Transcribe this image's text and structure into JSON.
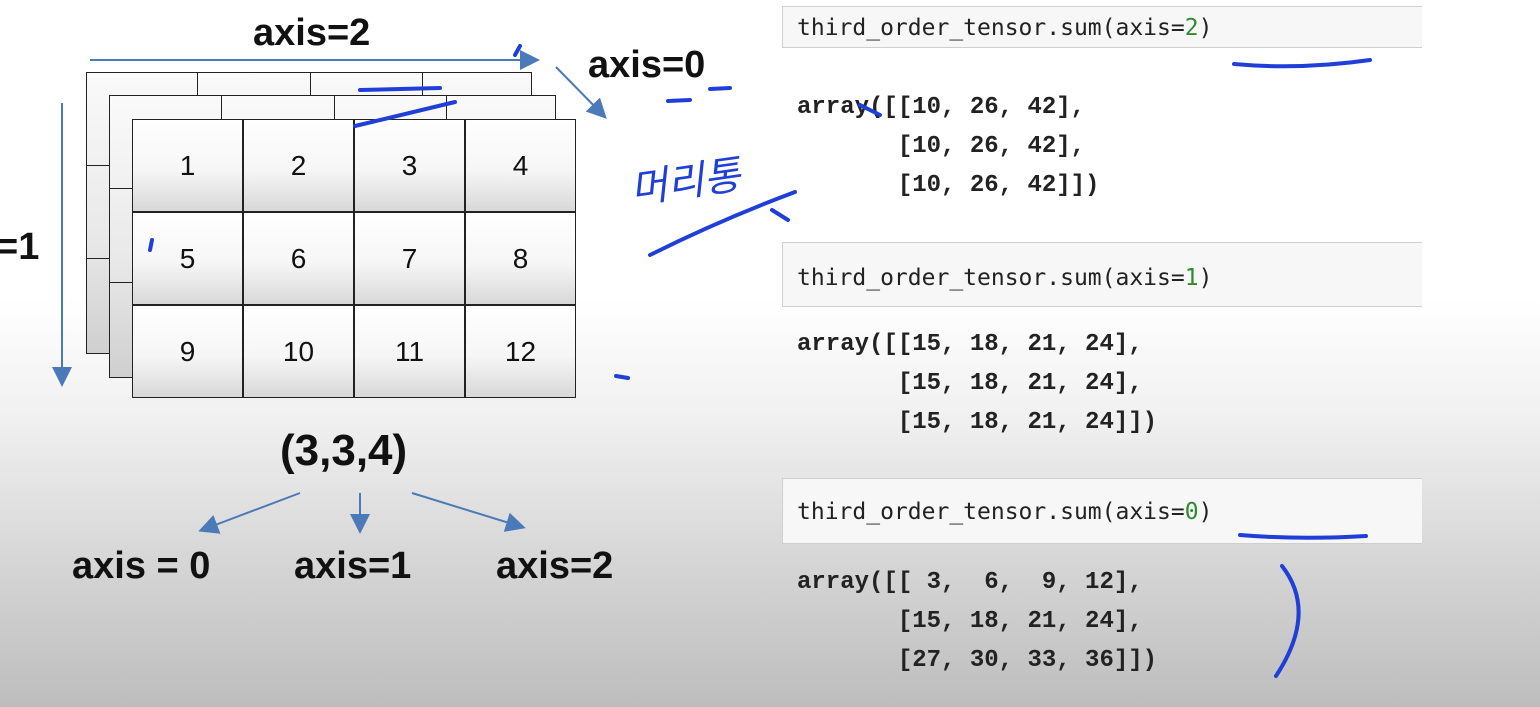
{
  "diagram": {
    "top_label": "axis=2",
    "left_label": "=1",
    "right_top_label": "axis=0",
    "shape_label": "(3,3,4)",
    "axis_labels": [
      "axis = 0",
      "axis=1",
      "axis=2"
    ],
    "cells": [
      "1",
      "2",
      "3",
      "4",
      "5",
      "6",
      "7",
      "8",
      "9",
      "10",
      "11",
      "12"
    ],
    "handwriting": "머리통"
  },
  "cells_code": [
    {
      "prefix": "third_order_tensor.sum(axis=",
      "num": "2",
      "suffix": ")",
      "output": "array([[10, 26, 42],\n       [10, 26, 42],\n       [10, 26, 42]])"
    },
    {
      "prefix": "third_order_tensor.sum(axis=",
      "num": "1",
      "suffix": ")",
      "output": "array([[15, 18, 21, 24],\n       [15, 18, 21, 24],\n       [15, 18, 21, 24]])"
    },
    {
      "prefix": "third_order_tensor.sum(axis=",
      "num": "0",
      "suffix": ")",
      "output": "array([[ 3,  6,  9, 12],\n       [15, 18, 21, 24],\n       [27, 30, 33, 36]])"
    }
  ],
  "colors": {
    "ink": "#1f3fd8",
    "arrow": "#4a7ab8",
    "code_number": "#2e8b2e"
  }
}
